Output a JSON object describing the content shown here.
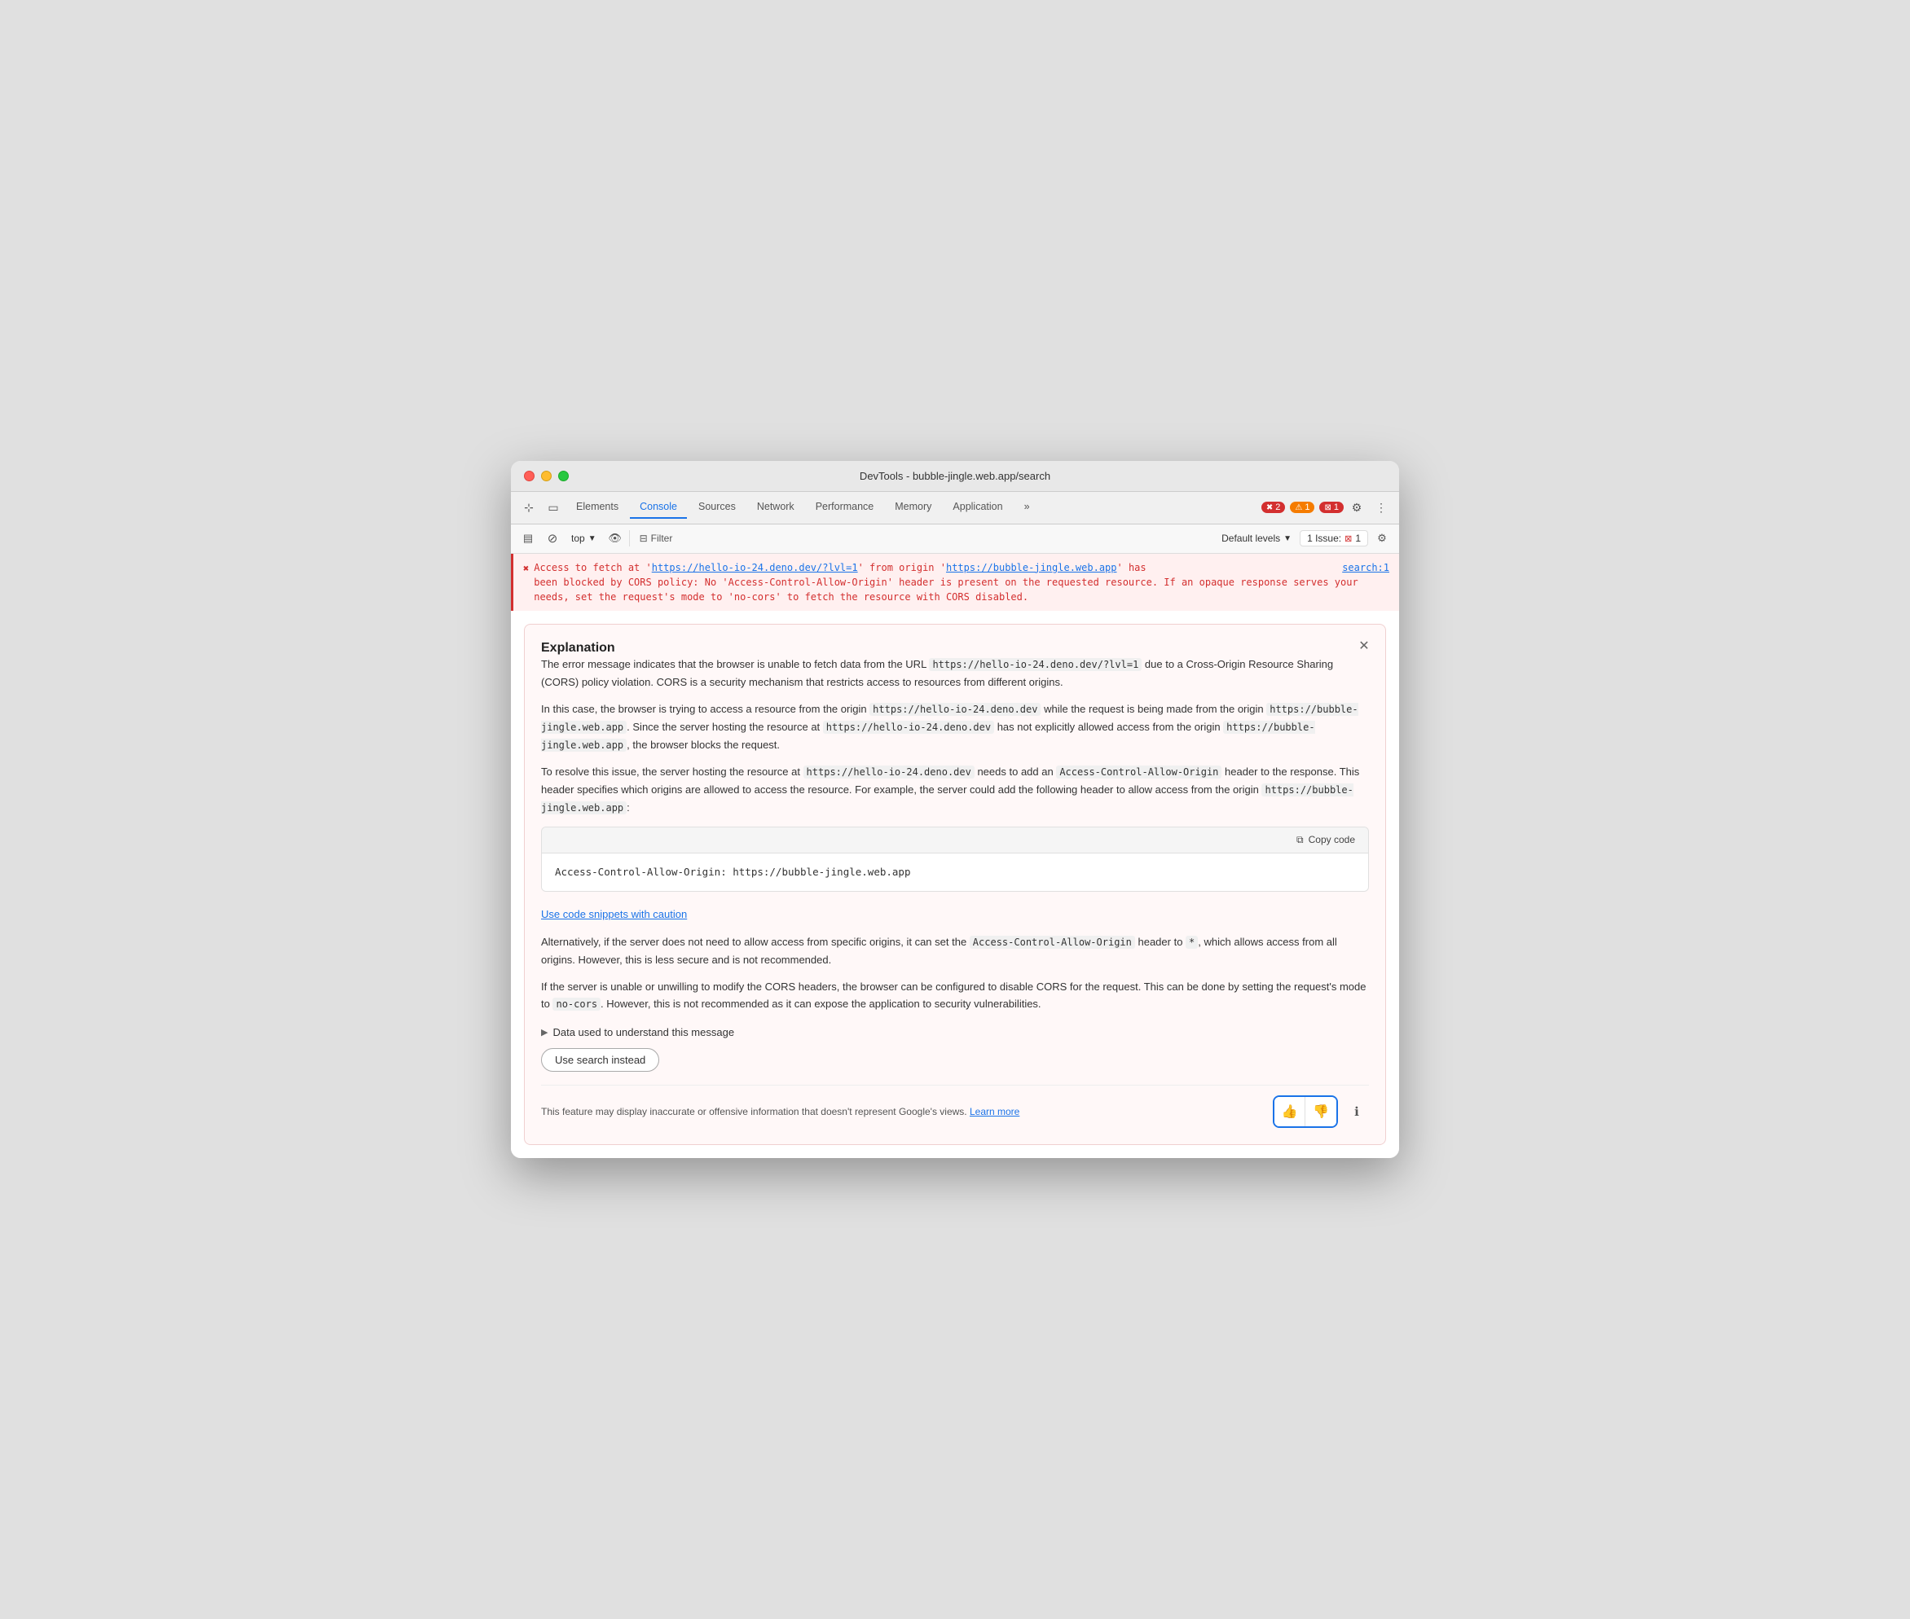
{
  "window": {
    "title": "DevTools - bubble-jingle.web.app/search"
  },
  "nav": {
    "tabs": [
      {
        "label": "Elements",
        "active": false
      },
      {
        "label": "Console",
        "active": true
      },
      {
        "label": "Sources",
        "active": false
      },
      {
        "label": "Network",
        "active": false
      },
      {
        "label": "Performance",
        "active": false
      },
      {
        "label": "Memory",
        "active": false
      },
      {
        "label": "Application",
        "active": false
      }
    ],
    "more_label": "»",
    "error_count": "2",
    "warn_count": "1",
    "info_count": "1",
    "gear_icon": "⚙",
    "more_icon": "⋮"
  },
  "console_toolbar": {
    "context": "top",
    "filter_label": "Filter",
    "default_levels_label": "Default levels",
    "issue_label": "1 Issue:",
    "issue_count": "1"
  },
  "error": {
    "message_start": "Access to fetch at '",
    "url1": "https://hello-io-24.deno.dev/?lvl=1",
    "middle1": "' from origin '",
    "url2": "https://bubble-jingle.web.app",
    "message_end": "' has",
    "message_cont": "been blocked by CORS policy: No 'Access-Control-Allow-Origin' header is present on the requested resource. If an opaque response serves your needs, set the request's mode to 'no-cors' to fetch the resource with CORS disabled.",
    "source": "search:1"
  },
  "explanation": {
    "title": "Explanation",
    "paragraphs": [
      "The error message indicates that the browser is unable to fetch data from the URL https://hello-io-24.deno.dev/?lvl=1 due to a Cross-Origin Resource Sharing (CORS) policy violation. CORS is a security mechanism that restricts access to resources from different origins.",
      "In this case, the browser is trying to access a resource from the origin https://hello-io-24.deno.dev while the request is being made from the origin https://bubble-jingle.web.app. Since the server hosting the resource at https://hello-io-24.deno.dev has not explicitly allowed access from the origin https://bubble-jingle.web.app, the browser blocks the request.",
      "To resolve this issue, the server hosting the resource at https://hello-io-24.deno.dev needs to add an Access-Control-Allow-Origin header to the response. This header specifies which origins are allowed to access the resource. For example, the server could add the following header to allow access from the origin https://bubble-jingle.web.app:"
    ],
    "code_snippet": "Access-Control-Allow-Origin: https://bubble-jingle.web.app",
    "copy_code_label": "Copy code",
    "caution_label": "Use code snippets with caution",
    "alt_paragraph": "Alternatively, if the server does not need to allow access from specific origins, it can set the Access-Control-Allow-Origin header to *, which allows access from all origins. However, this is less secure and is not recommended.",
    "final_paragraph": "If the server is unable or unwilling to modify the CORS headers, the browser can be configured to disable CORS for the request. This can be done by setting the request's mode to no-cors. However, this is not recommended as it can expose the application to security vulnerabilities.",
    "data_toggle_label": "Data used to understand this message",
    "use_search_label": "Use search instead",
    "disclaimer_text": "This feature may display inaccurate or offensive information that doesn't represent Google's views.",
    "learn_more_label": "Learn more",
    "thumbs_up": "👍",
    "thumbs_down": "👎",
    "info_icon": "ℹ"
  }
}
